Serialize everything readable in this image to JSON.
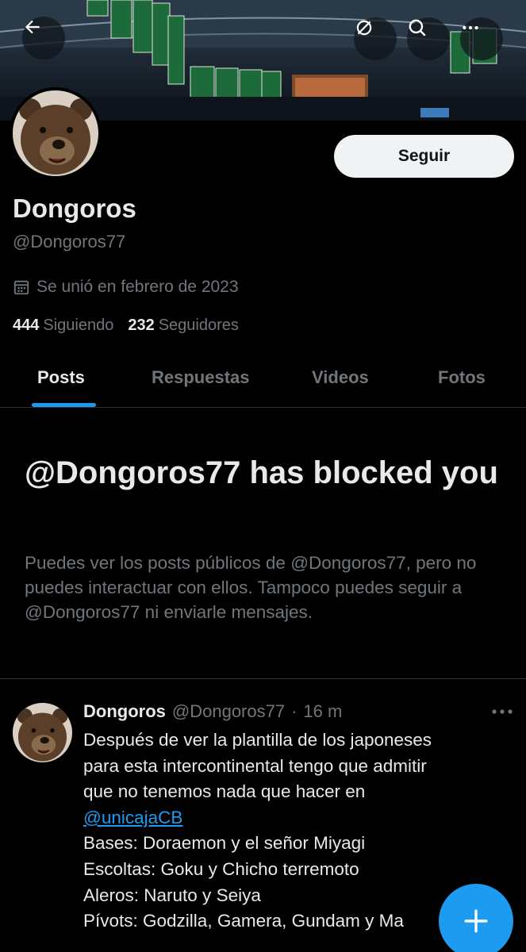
{
  "profile": {
    "display_name": "Dongoros",
    "handle": "@Dongoros77",
    "joined": "Se unió en febrero de 2023",
    "following_count": "444",
    "following_label": "Siguiendo",
    "followers_count": "232",
    "followers_label": "Seguidores",
    "follow_button": "Seguir"
  },
  "tabs": [
    {
      "label": "Posts",
      "active": true
    },
    {
      "label": "Respuestas",
      "active": false
    },
    {
      "label": "Videos",
      "active": false
    },
    {
      "label": "Fotos",
      "active": false
    }
  ],
  "blocked": {
    "title": "@Dongoros77 has blocked you",
    "body": "Puedes ver los posts públicos de @Dongoros77, pero no puedes interactuar con ellos. Tampoco puedes seguir a @Dongoros77 ni enviarle mensajes."
  },
  "post": {
    "author": "Dongoros",
    "handle": "@Dongoros77",
    "separator": "·",
    "time": "16 m",
    "lines": [
      "Después de ver la plantilla de los japoneses",
      "para esta intercontinental tengo que admitir",
      "que no tenemos nada que hacer en"
    ],
    "mention": "@unicajaCB",
    "lines_after": [
      "Bases: Doraemon y el señor Miyagi",
      "Escoltas: Goku y Chicho terremoto",
      "Aleros: Naruto y Seiya",
      "Pívots: Godzilla, Gamera, Gundam y Ma"
    ]
  },
  "icons": {
    "back": "arrow-left-icon",
    "grok": "grok-icon",
    "search": "search-icon",
    "more": "more-horizontal-icon",
    "calendar": "calendar-icon",
    "compose": "plus-icon"
  },
  "colors": {
    "accent": "#1d9bf0",
    "background": "#000000",
    "text_primary": "#e7e9ea",
    "text_secondary": "#71767b"
  }
}
